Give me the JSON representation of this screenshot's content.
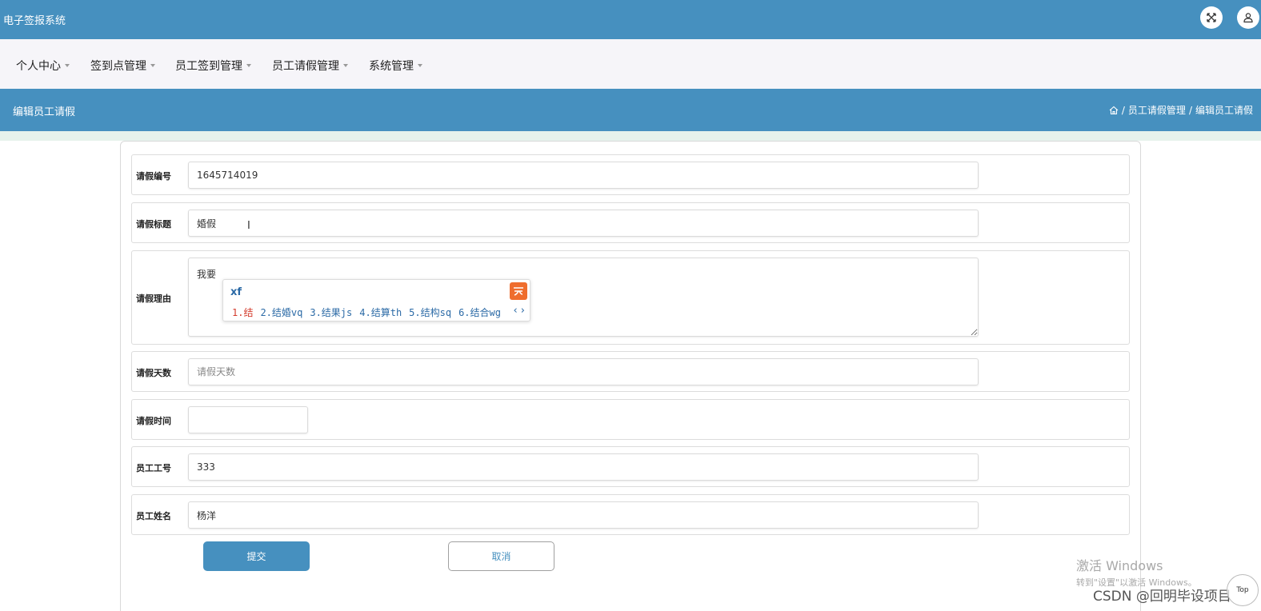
{
  "app": {
    "title": "电子签报系统"
  },
  "nav": [
    {
      "label": "个人中心"
    },
    {
      "label": "签到点管理"
    },
    {
      "label": "员工签到管理"
    },
    {
      "label": "员工请假管理"
    },
    {
      "label": "系统管理"
    }
  ],
  "header": {
    "page_title": "编辑员工请假",
    "breadcrumb": [
      "员工请假管理",
      "编辑员工请假"
    ],
    "separator": "/"
  },
  "form": {
    "leave_no": {
      "label": "请假编号",
      "value": "1645714019"
    },
    "leave_title": {
      "label": "请假标题",
      "value": "婚假"
    },
    "leave_reason": {
      "label": "请假理由",
      "value": "我要"
    },
    "leave_days": {
      "label": "请假天数",
      "value": "",
      "placeholder": "请假天数"
    },
    "leave_time": {
      "label": "请假时间",
      "value": ""
    },
    "emp_no": {
      "label": "员工工号",
      "value": "333"
    },
    "emp_name": {
      "label": "员工姓名",
      "value": "杨洋"
    }
  },
  "buttons": {
    "submit": "提交",
    "cancel": "取消"
  },
  "ime": {
    "input": "xf",
    "candidates": [
      "1.结",
      "2.结婚vq",
      "3.结果js",
      "4.结算th",
      "5.结构sq",
      "6.结合wg"
    ],
    "arrows": "‹ ›"
  },
  "overlay": {
    "activation_title": "激活 Windows",
    "activation_sub": "转到\"设置\"以激活 Windows。",
    "csdn": "CSDN @回明毕设项目",
    "top_label": "Top"
  },
  "colors": {
    "primary": "#4690bf",
    "nav_bg": "#f6f5f9",
    "ime_accent": "#ef6d2d"
  }
}
